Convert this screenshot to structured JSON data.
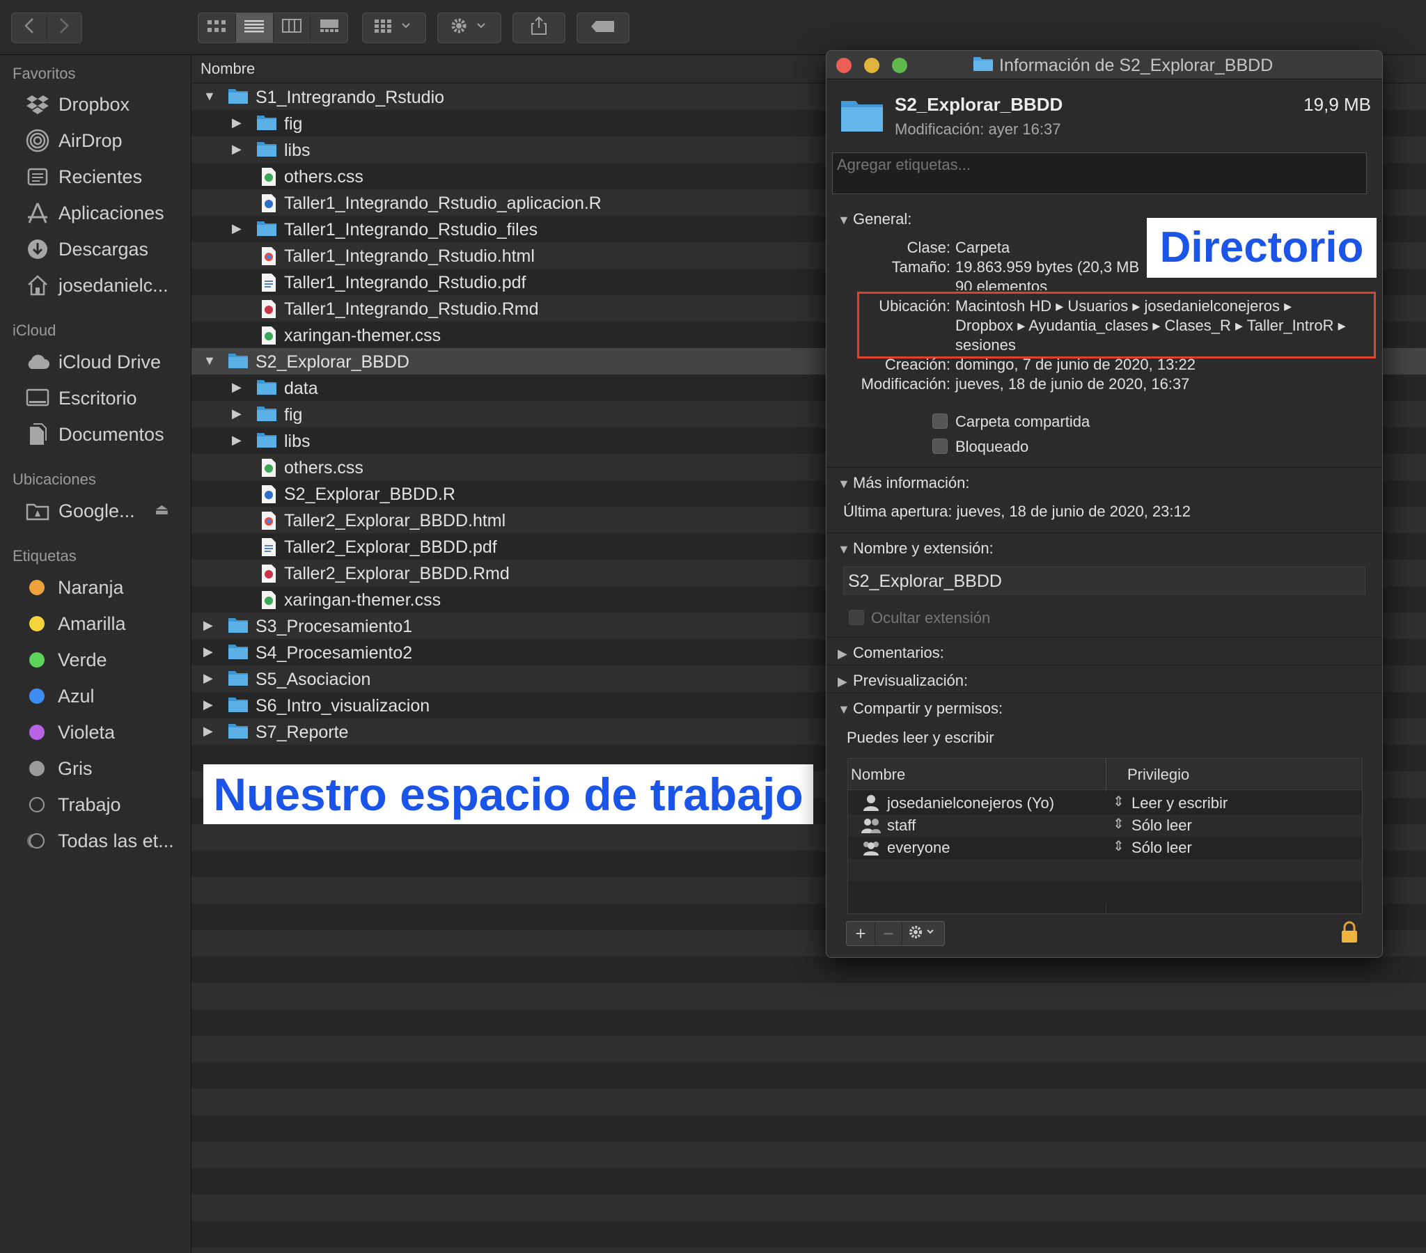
{
  "toolbar": {
    "back_icon": "chevron-left-icon",
    "forward_icon": "chevron-right-icon"
  },
  "sidebar": {
    "sections": {
      "favoritos": "Favoritos",
      "icloud": "iCloud",
      "ubicaciones": "Ubicaciones",
      "etiquetas": "Etiquetas"
    },
    "favoritos": [
      {
        "label": "Dropbox",
        "icon": "dropbox-icon"
      },
      {
        "label": "AirDrop",
        "icon": "airdrop-icon"
      },
      {
        "label": "Recientes",
        "icon": "recents-icon"
      },
      {
        "label": "Aplicaciones",
        "icon": "applications-icon"
      },
      {
        "label": "Descargas",
        "icon": "downloads-icon"
      },
      {
        "label": "josedanielc...",
        "icon": "home-icon"
      }
    ],
    "icloud": [
      {
        "label": "iCloud Drive",
        "icon": "cloud-icon"
      },
      {
        "label": "Escritorio",
        "icon": "desktop-icon"
      },
      {
        "label": "Documentos",
        "icon": "documents-icon"
      }
    ],
    "ubicaciones": [
      {
        "label": "Google...",
        "icon": "drive-icon"
      }
    ],
    "etiquetas": [
      {
        "label": "Naranja",
        "color": "#f0a33c"
      },
      {
        "label": "Amarilla",
        "color": "#f5d33a"
      },
      {
        "label": "Verde",
        "color": "#5ed35a"
      },
      {
        "label": "Azul",
        "color": "#3d8df5"
      },
      {
        "label": "Violeta",
        "color": "#b863e6"
      },
      {
        "label": "Gris",
        "color": "#9a9a9a"
      },
      {
        "label": "Trabajo",
        "color": "none"
      },
      {
        "label": "Todas las et...",
        "color": "all"
      }
    ]
  },
  "filelist": {
    "column_header": "Nombre",
    "rows": [
      {
        "name": "S1_Intregrando_Rstudio",
        "type": "folder",
        "expanded": true
      },
      {
        "name": "fig",
        "type": "folder",
        "child": true
      },
      {
        "name": "libs",
        "type": "folder",
        "child": true
      },
      {
        "name": "others.css",
        "type": "css",
        "child": true
      },
      {
        "name": "Taller1_Integrando_Rstudio_aplicacion.R",
        "type": "r",
        "child": true
      },
      {
        "name": "Taller1_Integrando_Rstudio_files",
        "type": "folder",
        "child": true
      },
      {
        "name": "Taller1_Integrando_Rstudio.html",
        "type": "html",
        "child": true
      },
      {
        "name": "Taller1_Integrando_Rstudio.pdf",
        "type": "pdf",
        "child": true
      },
      {
        "name": "Taller1_Integrando_Rstudio.Rmd",
        "type": "rmd",
        "child": true
      },
      {
        "name": "xaringan-themer.css",
        "type": "css",
        "child": true
      },
      {
        "name": "S2_Explorar_BBDD",
        "type": "folder",
        "expanded": true,
        "selected": true
      },
      {
        "name": "data",
        "type": "folder",
        "child": true
      },
      {
        "name": "fig",
        "type": "folder",
        "child": true
      },
      {
        "name": "libs",
        "type": "folder",
        "child": true
      },
      {
        "name": "others.css",
        "type": "css",
        "child": true
      },
      {
        "name": "S2_Explorar_BBDD.R",
        "type": "r",
        "child": true
      },
      {
        "name": "Taller2_Explorar_BBDD.html",
        "type": "html",
        "child": true
      },
      {
        "name": "Taller2_Explorar_BBDD.pdf",
        "type": "pdf",
        "child": true
      },
      {
        "name": "Taller2_Explorar_BBDD.Rmd",
        "type": "rmd",
        "child": true
      },
      {
        "name": "xaringan-themer.css",
        "type": "css",
        "child": true
      },
      {
        "name": "S3_Procesamiento1",
        "type": "folder"
      },
      {
        "name": "S4_Procesamiento2",
        "type": "folder"
      },
      {
        "name": "S5_Asociacion",
        "type": "folder"
      },
      {
        "name": "S6_Intro_visualizacion",
        "type": "folder"
      },
      {
        "name": "S7_Reporte",
        "type": "folder"
      }
    ]
  },
  "annotations": {
    "workspace": "Nuestro espacio de trabajo",
    "directory": "Directorio",
    "highlight_color": "#e0412e"
  },
  "info": {
    "window_title": "Información de S2_Explorar_BBDD",
    "name": "S2_Explorar_BBDD",
    "size": "19,9 MB",
    "modified_short": "Modificación: ayer 16:37",
    "tags_placeholder": "Agregar etiquetas...",
    "general": {
      "title": "General:",
      "clase_label": "Clase:",
      "clase": "Carpeta",
      "tamano_label": "Tamaño:",
      "tamano": "19.863.959 bytes (20,3 MB",
      "elementos": "90 elementos",
      "ubicacion_label": "Ubicación:",
      "ubicacion_line1": "Macintosh HD ▸ Usuarios ▸ josedanielconejeros ▸",
      "ubicacion_line2": "Dropbox ▸ Ayudantia_clases ▸ Clases_R ▸ Taller_IntroR ▸",
      "ubicacion_line3": "sesiones",
      "creacion_label": "Creación:",
      "creacion": "domingo, 7 de junio de 2020, 13:22",
      "modificacion_label": "Modificación:",
      "modificacion": "jueves, 18 de junio de 2020, 16:37",
      "carpeta_compartida": "Carpeta compartida",
      "bloqueado": "Bloqueado"
    },
    "mas_info": {
      "title": "Más información:",
      "ultima_apertura": "Última apertura: jueves, 18 de junio de 2020, 23:12"
    },
    "nombre_ext": {
      "title": "Nombre y extensión:",
      "value": "S2_Explorar_BBDD",
      "ocultar": "Ocultar extensión"
    },
    "comentarios": "Comentarios:",
    "previsualizacion": "Previsualización:",
    "permisos": {
      "title": "Compartir y permisos:",
      "summary": "Puedes leer y escribir",
      "col_nombre": "Nombre",
      "col_privilegio": "Privilegio",
      "rows": [
        {
          "user": "josedanielconejeros (Yo)",
          "priv": "Leer y escribir",
          "icon": "user-icon"
        },
        {
          "user": "staff",
          "priv": "Sólo leer",
          "icon": "group-icon"
        },
        {
          "user": "everyone",
          "priv": "Sólo leer",
          "icon": "everyone-icon"
        }
      ]
    }
  }
}
